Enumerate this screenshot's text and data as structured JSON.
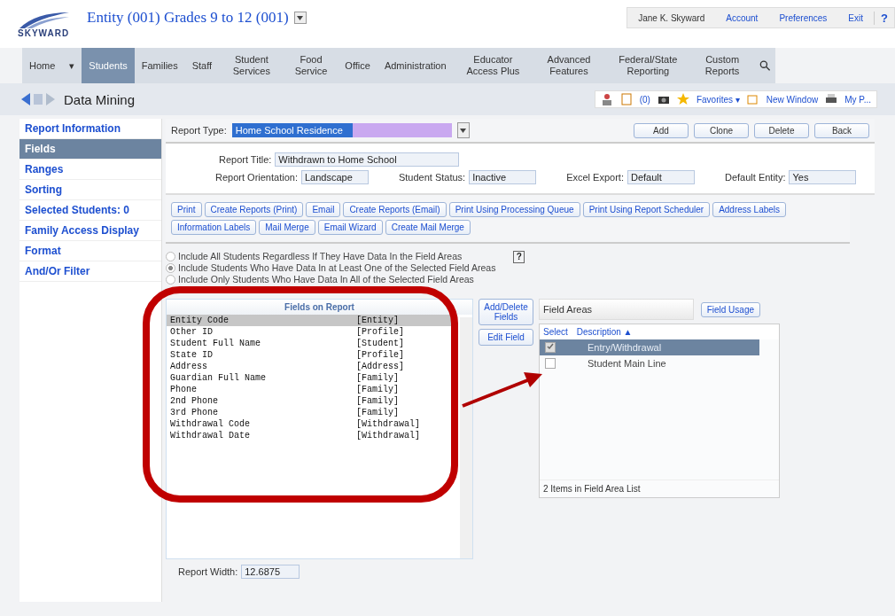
{
  "header": {
    "logo": "SKYWARD",
    "entity": "Entity (001) Grades 9 to 12 (001)",
    "links": [
      "Jane K. Skyward",
      "Account",
      "Preferences",
      "Exit"
    ],
    "help": "?"
  },
  "nav": [
    {
      "label": "Home",
      "selected": false
    },
    {
      "label": "▾",
      "selected": false
    },
    {
      "label": "Students",
      "selected": true
    },
    {
      "label": "Families",
      "selected": false
    },
    {
      "label": "Staff",
      "selected": false
    },
    {
      "label": "Student Services",
      "selected": false
    },
    {
      "label": "Food Service",
      "selected": false
    },
    {
      "label": "Office",
      "selected": false
    },
    {
      "label": "Administration",
      "selected": false
    },
    {
      "label": "Educator Access Plus",
      "selected": false
    },
    {
      "label": "Advanced Features",
      "selected": false
    },
    {
      "label": "Federal/State Reporting",
      "selected": false
    },
    {
      "label": "Custom Reports",
      "selected": false
    }
  ],
  "page_title": "Data Mining",
  "toolbar": {
    "count": "(0)",
    "favorites": "Favorites ▾",
    "new_window": "New Window",
    "print": "My P..."
  },
  "sidebar": [
    {
      "label": "Report Information",
      "selected": false
    },
    {
      "label": "Fields",
      "selected": true
    },
    {
      "label": "Ranges",
      "selected": false
    },
    {
      "label": "Sorting",
      "selected": false
    },
    {
      "label": "Selected Students: 0",
      "selected": false
    },
    {
      "label": "Family Access Display",
      "selected": false
    },
    {
      "label": "Format",
      "selected": false
    },
    {
      "label": "And/Or Filter",
      "selected": false
    }
  ],
  "report_type": {
    "label": "Report Type:",
    "value": "Home School Residence"
  },
  "top_buttons": [
    "Add",
    "Clone",
    "Delete",
    "Back"
  ],
  "report_title": {
    "label": "Report Title:",
    "value": "Withdrawn to Home School"
  },
  "settings": [
    {
      "label": "Report Orientation:",
      "value": "Landscape"
    },
    {
      "label": "Student Status:",
      "value": "Inactive"
    },
    {
      "label": "Excel Export:",
      "value": "Default"
    },
    {
      "label": "Default Entity:",
      "value": "Yes"
    }
  ],
  "action_buttons": [
    "Print",
    "Create Reports (Print)",
    "Email",
    "Create Reports (Email)",
    "Print Using Processing Queue",
    "Print Using Report Scheduler",
    "Address Labels",
    "Information Labels",
    "Mail Merge",
    "Email Wizard",
    "Create Mail Merge"
  ],
  "options": [
    {
      "label": "Include All Students Regardless If They Have Data In the Field Areas",
      "selected": false
    },
    {
      "label": "Include Students Who Have Data In at Least One of the Selected Field Areas",
      "selected": true
    },
    {
      "label": "Include Only Students Who Have Data In All of the Selected Field Areas",
      "selected": false
    }
  ],
  "help_icon": "?",
  "fields_on_report": {
    "title": "Fields on Report",
    "rows": [
      {
        "name": "Entity Code",
        "area": "[Entity]",
        "selected": true
      },
      {
        "name": "Other ID",
        "area": "[Profile]",
        "selected": false
      },
      {
        "name": "Student Full Name",
        "area": "[Student]",
        "selected": false
      },
      {
        "name": "State ID",
        "area": "[Profile]",
        "selected": false
      },
      {
        "name": "Address",
        "area": "[Address]",
        "selected": false
      },
      {
        "name": "Guardian Full Name",
        "area": "[Family]",
        "selected": false
      },
      {
        "name": "Phone",
        "area": "[Family]",
        "selected": false
      },
      {
        "name": "2nd Phone",
        "area": "[Family]",
        "selected": false
      },
      {
        "name": "3rd Phone",
        "area": "[Family]",
        "selected": false
      },
      {
        "name": "Withdrawal Code",
        "area": "[Withdrawal]",
        "selected": false
      },
      {
        "name": "Withdrawal Date",
        "area": "[Withdrawal]",
        "selected": false
      }
    ]
  },
  "field_buttons": [
    "Add/Delete Fields",
    "Edit Field"
  ],
  "field_areas": {
    "title": "Field Areas",
    "button": "Field Usage",
    "columns": [
      "Select",
      "Description ▲"
    ],
    "rows": [
      {
        "description": "Entry/Withdrawal",
        "checked": true,
        "selected": true
      },
      {
        "description": "Student Main Line",
        "checked": false,
        "selected": false
      }
    ],
    "footer": "2 Items in Field Area List"
  },
  "report_width": {
    "label": "Report Width:",
    "value": "12.6875"
  }
}
